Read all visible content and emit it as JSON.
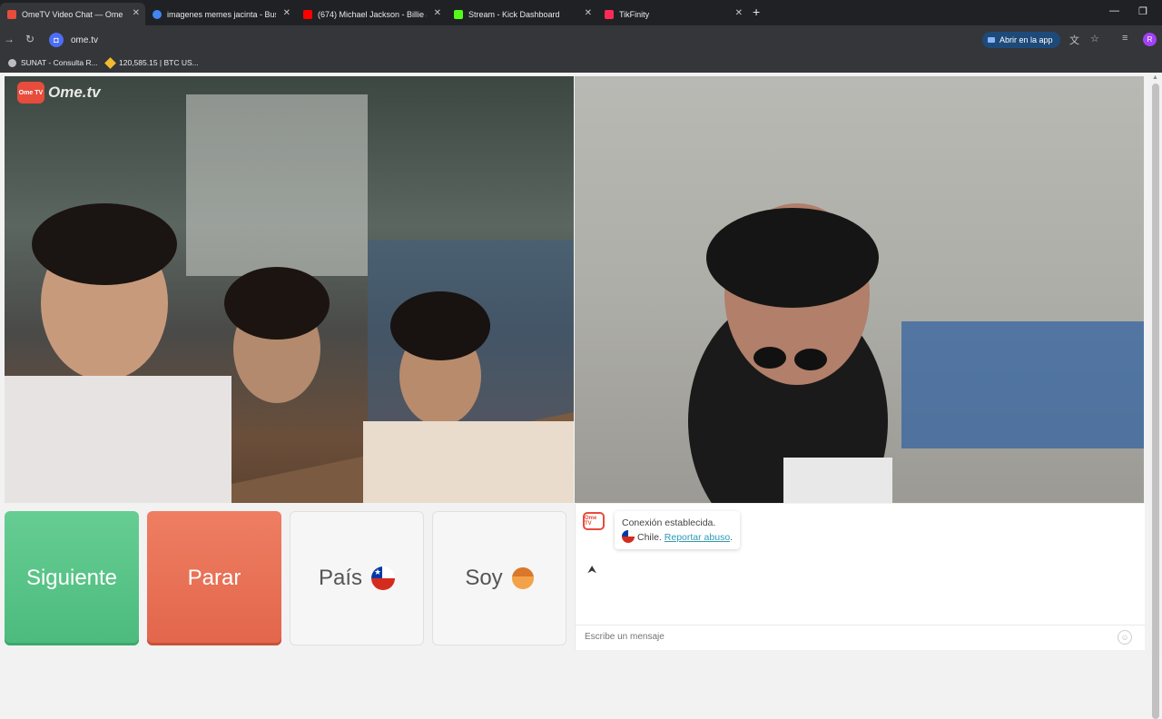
{
  "browser": {
    "tabs": [
      {
        "label": "OmeTV Video Chat — Ome",
        "color": "#e74c3c",
        "active": true
      },
      {
        "label": "imagenes memes jacinta - Busc",
        "color": "#4285f4",
        "active": false
      },
      {
        "label": "(674) Michael Jackson - Billie Je",
        "color": "#ff0000",
        "active": false
      },
      {
        "label": "Stream - Kick Dashboard",
        "color": "#53fc18",
        "active": false
      },
      {
        "label": "TikFinity",
        "color": "#fe2c55",
        "active": false
      }
    ],
    "url": "ome.tv",
    "open_app_label": "Abrir en la app",
    "profile_initial": "R",
    "bookmarks": [
      {
        "label": "SUNAT - Consulta R..."
      },
      {
        "label": "120,585.15 | BTC US..."
      }
    ]
  },
  "page": {
    "logo": {
      "badge": "Ome TV",
      "text": "Ome.tv"
    },
    "buttons": {
      "next": "Siguiente",
      "stop": "Parar",
      "country": "País",
      "gender": "Soy"
    },
    "chat": {
      "logo_badge": "Ome TV",
      "connection": "Conexión establecida.",
      "country": "Chile.",
      "report": "Reportar abuso",
      "report_suffix": ".",
      "placeholder": "Escribe un mensaje"
    },
    "colors": {
      "next": "#4cbb7d",
      "stop": "#e2664b",
      "brand": "#e74c3c"
    }
  }
}
